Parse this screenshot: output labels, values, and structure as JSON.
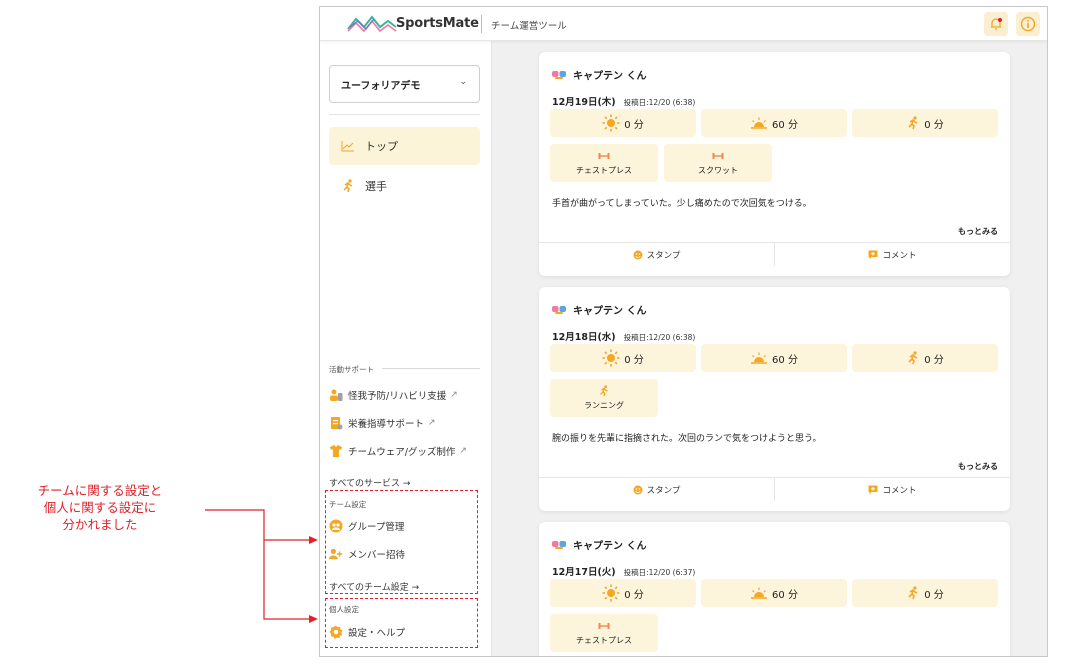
{
  "annotation": {
    "line1": "チームに関する設定と",
    "line2": "個人に関する設定に",
    "line3": "分かれました",
    "color": "#e0202a"
  },
  "header": {
    "app_name": "SportsMate",
    "subtitle": "チーム運営ツール",
    "bell_icon": "bell-icon",
    "info_icon": "info-icon",
    "accent": "#f5a623"
  },
  "sidebar": {
    "team_select": "ユーフォリアデモ",
    "nav": [
      {
        "label": "トップ",
        "icon": "chart-line-icon",
        "active": true
      },
      {
        "label": "選手",
        "icon": "runner-icon",
        "active": false
      }
    ],
    "support": {
      "label": "活動サポート",
      "items": [
        {
          "label": "怪我予防/リハビリ支援",
          "icon": "rehab-icon"
        },
        {
          "label": "栄養指導サポート",
          "icon": "nutrition-icon"
        },
        {
          "label": "チームウェア/グッズ制作",
          "icon": "tshirt-icon"
        }
      ],
      "all_link": "すべてのサービス →"
    },
    "team_settings": {
      "label": "チーム設定",
      "items": [
        {
          "label": "グループ管理",
          "icon": "group-icon"
        },
        {
          "label": "メンバー招待",
          "icon": "add-member-icon"
        }
      ],
      "all_link": "すべてのチーム設定 →"
    },
    "personal_settings": {
      "label": "個人設定",
      "items": [
        {
          "label": "設定・ヘルプ",
          "icon": "gear-icon"
        }
      ]
    }
  },
  "feed": {
    "cards": [
      {
        "author": "キャプテン くん",
        "date": "12月19日(木)",
        "posted": "投稿日:12/20 (6:38)",
        "stats": [
          "0 分",
          "60 分",
          "0 分"
        ],
        "activities": [
          {
            "label": "チェストプレス",
            "icon": "dumbbell-icon"
          },
          {
            "label": "スクワット",
            "icon": "dumbbell-icon"
          }
        ],
        "body": "手首が曲がってしまっていた。少し痛めたので次回気をつける。",
        "more": "もっとみる",
        "stamp": "スタンプ",
        "comment": "コメント"
      },
      {
        "author": "キャプテン くん",
        "date": "12月18日(水)",
        "posted": "投稿日:12/20 (6:38)",
        "stats": [
          "0 分",
          "60 分",
          "0 分"
        ],
        "activities": [
          {
            "label": "ランニング",
            "icon": "runner-icon"
          }
        ],
        "body": "腕の振りを先輩に指摘された。次回のランで気をつけようと思う。",
        "more": "もっとみる",
        "stamp": "スタンプ",
        "comment": "コメント"
      },
      {
        "author": "キャプテン くん",
        "date": "12月17日(火)",
        "posted": "投稿日:12/20 (6:37)",
        "stats": [
          "0 分",
          "60 分",
          "0 分"
        ],
        "activities": [
          {
            "label": "チェストプレス",
            "icon": "dumbbell-icon"
          }
        ]
      }
    ]
  }
}
